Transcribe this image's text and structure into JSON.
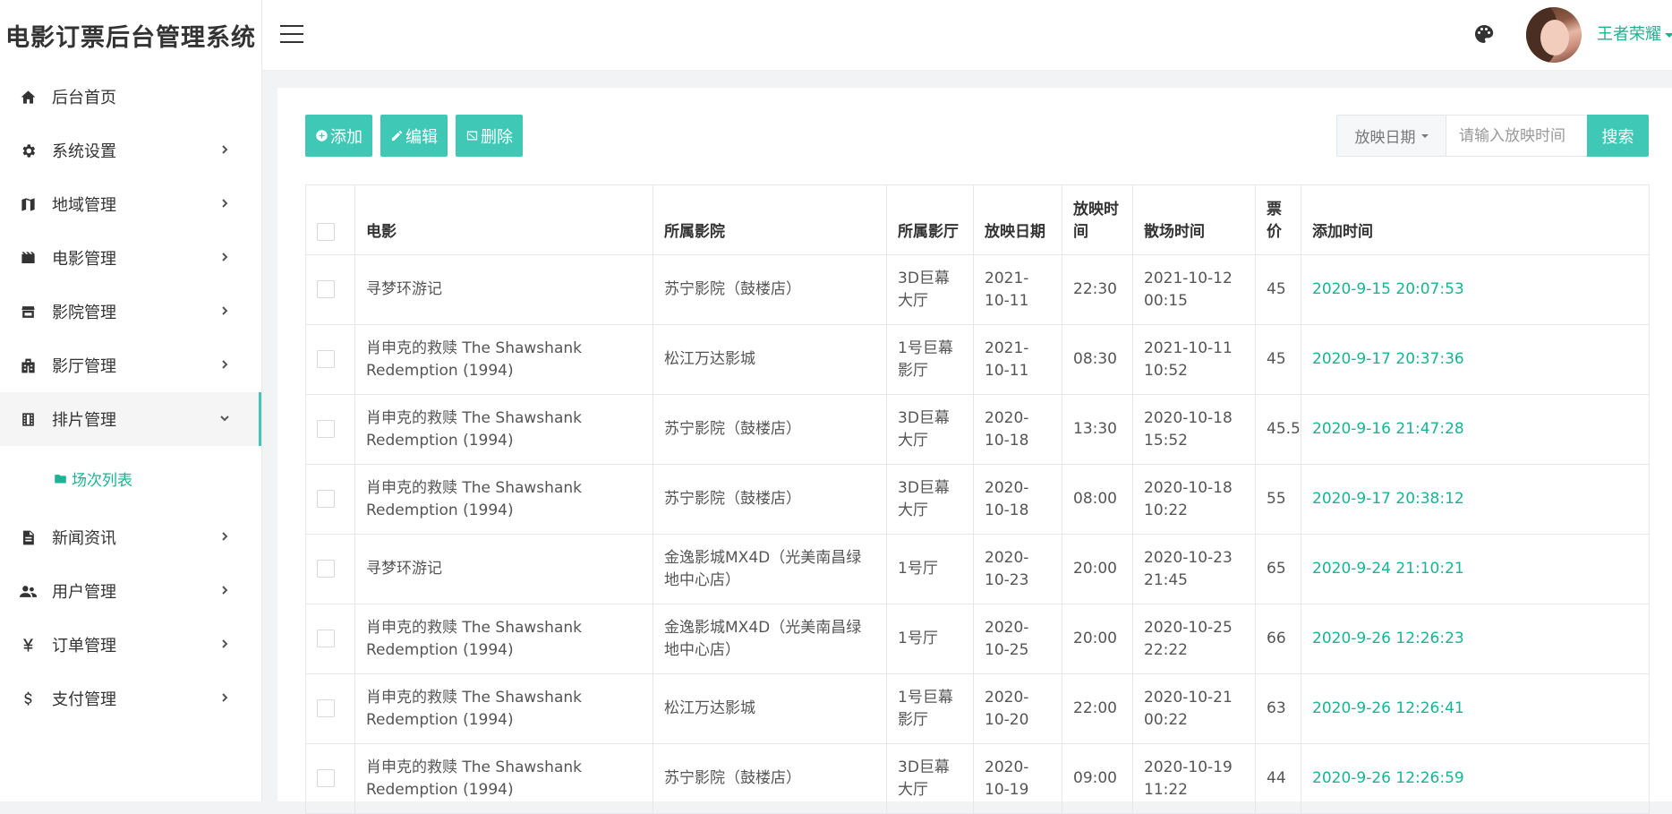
{
  "app": {
    "title": "电影订票后台管理系统"
  },
  "header": {
    "user_name": "王者荣耀"
  },
  "sidebar": {
    "items": [
      {
        "label": "后台首页",
        "icon": "home-icon"
      },
      {
        "label": "系统设置",
        "icon": "gear-icon"
      },
      {
        "label": "地域管理",
        "icon": "map-icon"
      },
      {
        "label": "电影管理",
        "icon": "film-icon"
      },
      {
        "label": "影院管理",
        "icon": "store-icon"
      },
      {
        "label": "影厅管理",
        "icon": "building-icon"
      },
      {
        "label": "排片管理",
        "icon": "filmstrip-icon",
        "expanded": true
      },
      {
        "label": "新闻资讯",
        "icon": "document-icon"
      },
      {
        "label": "用户管理",
        "icon": "users-icon"
      },
      {
        "label": "订单管理",
        "icon": "yen-icon"
      },
      {
        "label": "支付管理",
        "icon": "dollar-icon"
      }
    ],
    "sub_item": {
      "label": "场次列表",
      "icon": "folder-icon"
    }
  },
  "toolbar": {
    "add_label": "添加",
    "edit_label": "编辑",
    "delete_label": "删除"
  },
  "search": {
    "select_value": "放映日期",
    "placeholder": "请输入放映时间",
    "button_label": "搜索"
  },
  "table": {
    "columns": [
      "电影",
      "所属影院",
      "所属影厅",
      "放映日期",
      "放映时间",
      "散场时间",
      "票价",
      "添加时间"
    ],
    "rows": [
      [
        "寻梦环游记",
        "苏宁影院（鼓楼店）",
        "3D巨幕大厅",
        "2021-10-11",
        "22:30",
        "2021-10-12 00:15",
        "45",
        "2020-9-15 20:07:53"
      ],
      [
        "肖申克的救赎 The Shawshank Redemption (1994)",
        "松江万达影城",
        "1号巨幕影厅",
        "2021-10-11",
        "08:30",
        "2021-10-11 10:52",
        "45",
        "2020-9-17 20:37:36"
      ],
      [
        "肖申克的救赎 The Shawshank Redemption (1994)",
        "苏宁影院（鼓楼店）",
        "3D巨幕大厅",
        "2020-10-18",
        "13:30",
        "2020-10-18 15:52",
        "45.5",
        "2020-9-16 21:47:28"
      ],
      [
        "肖申克的救赎 The Shawshank Redemption (1994)",
        "苏宁影院（鼓楼店）",
        "3D巨幕大厅",
        "2020-10-18",
        "08:00",
        "2020-10-18 10:22",
        "55",
        "2020-9-17 20:38:12"
      ],
      [
        "寻梦环游记",
        "金逸影城MX4D（光美南昌绿地中心店）",
        "1号厅",
        "2020-10-23",
        "20:00",
        "2020-10-23 21:45",
        "65",
        "2020-9-24 21:10:21"
      ],
      [
        "肖申克的救赎 The Shawshank Redemption (1994)",
        "金逸影城MX4D（光美南昌绿地中心店）",
        "1号厅",
        "2020-10-25",
        "20:00",
        "2020-10-25 22:22",
        "66",
        "2020-9-26 12:26:23"
      ],
      [
        "肖申克的救赎 The Shawshank Redemption (1994)",
        "松江万达影城",
        "1号巨幕影厅",
        "2020-10-20",
        "22:00",
        "2020-10-21 00:22",
        "63",
        "2020-9-26 12:26:41"
      ],
      [
        "肖申克的救赎 The Shawshank Redemption (1994)",
        "苏宁影院（鼓楼店）",
        "3D巨幕大厅",
        "2020-10-19",
        "09:00",
        "2020-10-19 11:22",
        "44",
        "2020-9-26 12:26:59"
      ]
    ]
  }
}
